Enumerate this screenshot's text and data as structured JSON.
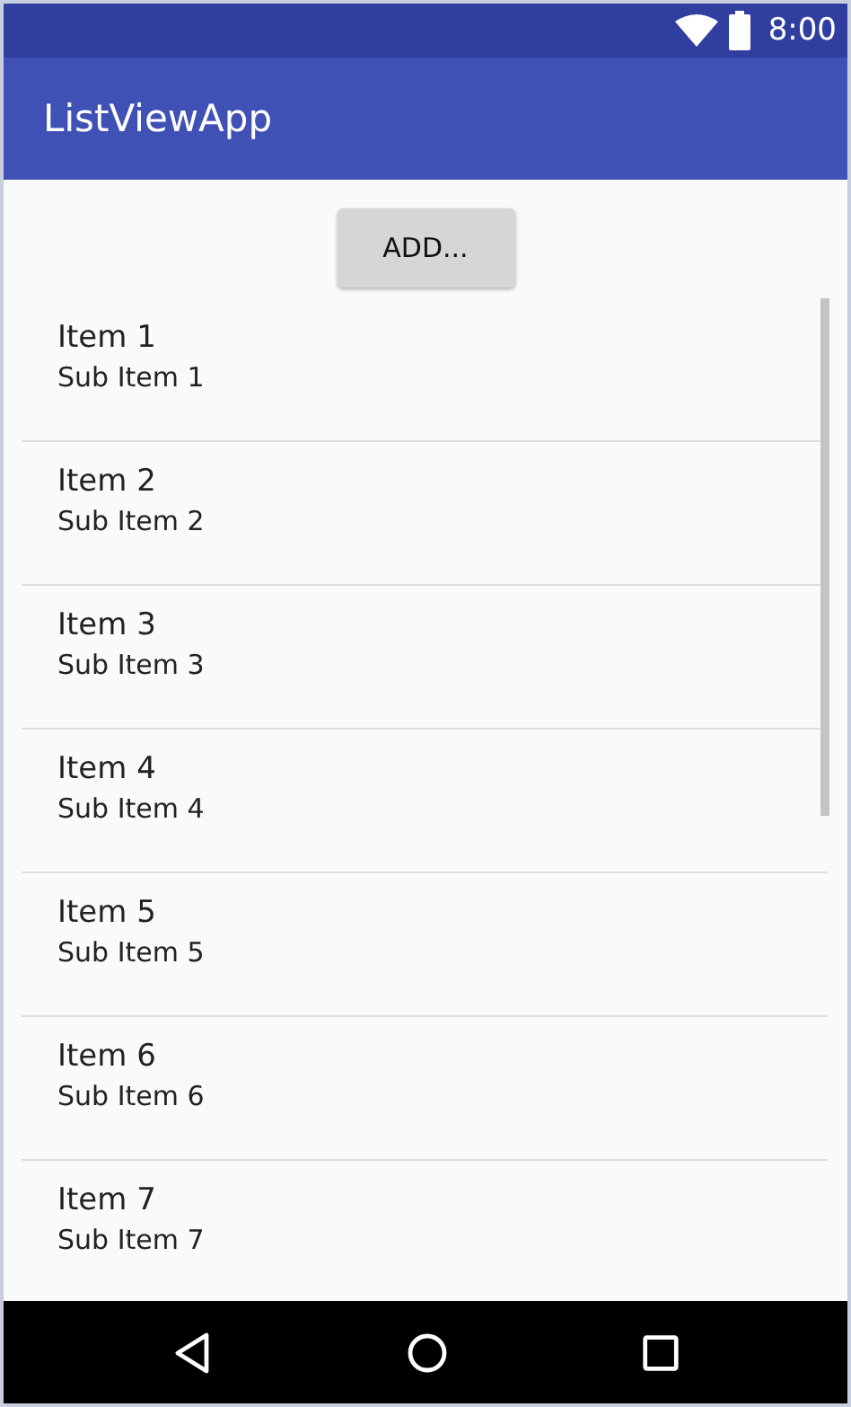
{
  "status_bar": {
    "time": "8:00"
  },
  "app_bar": {
    "title": "ListViewApp"
  },
  "add_button": {
    "label": "ADD..."
  },
  "list": {
    "items": [
      {
        "title": "Item 1",
        "subtitle": "Sub Item 1"
      },
      {
        "title": "Item 2",
        "subtitle": "Sub Item 2"
      },
      {
        "title": "Item 3",
        "subtitle": "Sub Item 3"
      },
      {
        "title": "Item 4",
        "subtitle": "Sub Item 4"
      },
      {
        "title": "Item 5",
        "subtitle": "Sub Item 5"
      },
      {
        "title": "Item 6",
        "subtitle": "Sub Item 6"
      },
      {
        "title": "Item 7",
        "subtitle": "Sub Item 7"
      }
    ]
  }
}
